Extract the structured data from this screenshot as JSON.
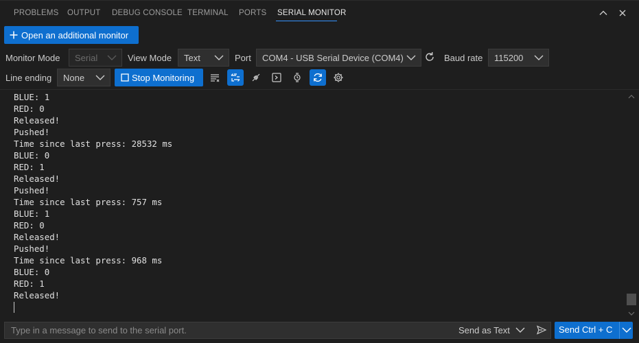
{
  "tabs": [
    {
      "label": "PROBLEMS",
      "active": false
    },
    {
      "label": "OUTPUT",
      "active": false
    },
    {
      "label": "DEBUG CONSOLE",
      "active": false
    },
    {
      "label": "TERMINAL",
      "active": false
    },
    {
      "label": "PORTS",
      "active": false
    },
    {
      "label": "SERIAL MONITOR",
      "active": true
    }
  ],
  "panel_actions": {
    "maximize_icon": "chevron-up-icon",
    "close_icon": "close-icon"
  },
  "open_monitor_label": "Open an additional monitor",
  "monitor_mode": {
    "label": "Monitor Mode",
    "value": "Serial"
  },
  "view_mode": {
    "label": "View Mode",
    "value": "Text"
  },
  "port": {
    "label": "Port",
    "value": "COM4 - USB Serial Device (COM4)"
  },
  "baud_rate": {
    "label": "Baud rate",
    "value": "115200"
  },
  "line_ending": {
    "label": "Line ending",
    "value": "None"
  },
  "stop_monitoring_label": "Stop Monitoring",
  "toolbar_icons": [
    "clear-output-icon",
    "toggle-timestamp-icon",
    "connect-icon",
    "terminal-icon",
    "watch-icon",
    "auto-scroll-icon",
    "settings-icon"
  ],
  "output_lines": [
    "BLUE: 1",
    "RED: 0",
    "Released!",
    "Pushed!",
    "Time since last press: 28532 ms",
    "BLUE: 0",
    "RED: 1",
    "Released!",
    "Pushed!",
    "Time since last press: 757 ms",
    "BLUE: 1",
    "RED: 0",
    "Released!",
    "Pushed!",
    "Time since last press: 968 ms",
    "BLUE: 0",
    "RED: 1",
    "Released!"
  ],
  "send": {
    "placeholder": "Type in a message to send to the serial port.",
    "mode_label": "Send as Text",
    "button_label": "Send Ctrl + C"
  },
  "colors": {
    "accent": "#0e6fcf",
    "background": "#1e1e1e",
    "tab_active_underline": "#3794ff"
  }
}
